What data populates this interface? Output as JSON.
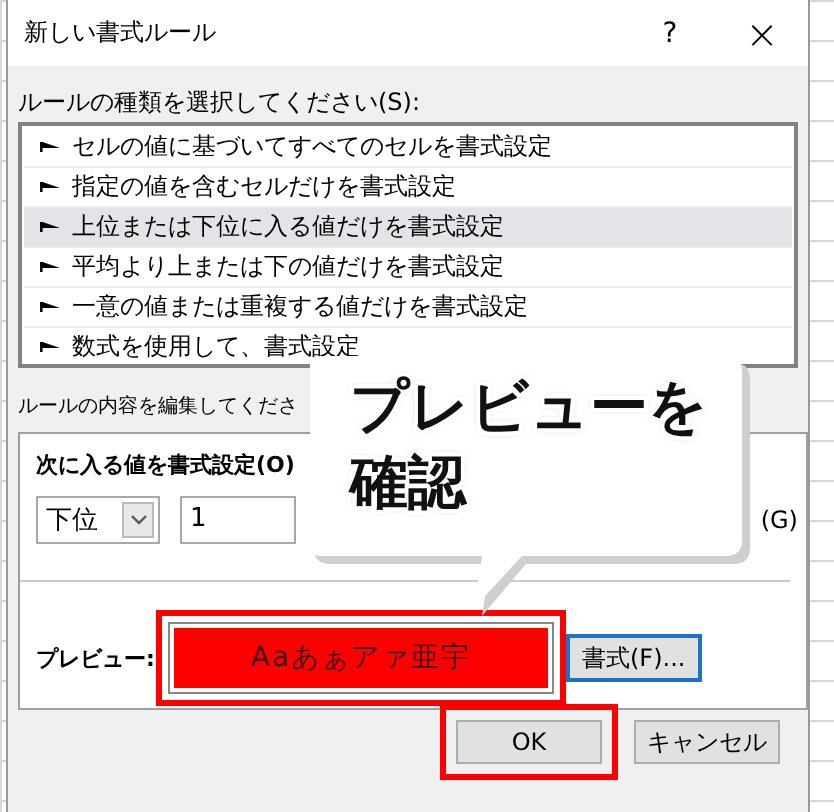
{
  "window": {
    "title": "新しい書式ルール",
    "help": "?",
    "close": "×"
  },
  "rule_type": {
    "label": "ルールの種類を選択してください(S):",
    "items": [
      {
        "label": "セルの値に基づいてすべてのセルを書式設定",
        "selected": false
      },
      {
        "label": "指定の値を含むセルだけを書式設定",
        "selected": false
      },
      {
        "label": "上位または下位に入る値だけを書式設定",
        "selected": true
      },
      {
        "label": "平均より上または下の値だけを書式設定",
        "selected": false
      },
      {
        "label": "一意の値または重複する値だけを書式設定",
        "selected": false
      },
      {
        "label": "数式を使用して、書式設定",
        "selected": false
      }
    ]
  },
  "rule_edit": {
    "label": "ルールの内容を編集してくださ",
    "heading": "次に入る値を書式設定(O)",
    "direction": {
      "value": "下位"
    },
    "count": {
      "value": "1"
    },
    "percent_label": "(G)",
    "preview_label": "プレビュー:",
    "preview": {
      "text": "Aaあぁアァ亜宇",
      "highlighted": true
    },
    "format_button": "書式(F)..."
  },
  "buttons": [
    {
      "label": "OK",
      "highlighted": true
    },
    {
      "label": "キャンセル",
      "highlighted": false
    }
  ],
  "callout": {
    "text": "プレビューを確認"
  }
}
